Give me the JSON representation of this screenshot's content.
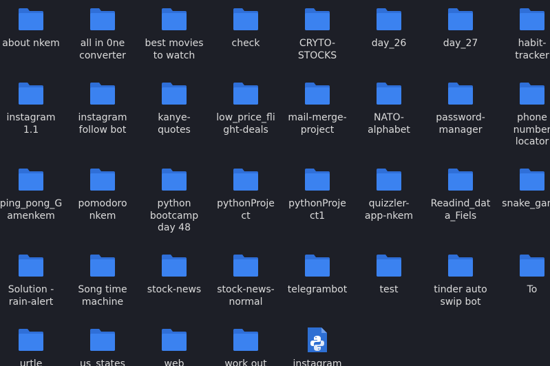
{
  "colors": {
    "background": "#1d1f27",
    "folder_back": "#2f6fd8",
    "folder_front": "#3b82f0",
    "label_text": "#dcdcdc",
    "file_body": "#2e6fd3",
    "file_fold": "#6fa0ec"
  },
  "items": [
    {
      "label": "about nkem",
      "icon": "folder-icon"
    },
    {
      "label": "all in 0ne converter",
      "icon": "folder-icon"
    },
    {
      "label": "best movies to watch",
      "icon": "folder-icon"
    },
    {
      "label": "check",
      "icon": "folder-icon"
    },
    {
      "label": "CRYTO-STOCKS",
      "icon": "folder-icon"
    },
    {
      "label": "day_26",
      "icon": "folder-icon"
    },
    {
      "label": "day_27",
      "icon": "folder-icon"
    },
    {
      "label": "habit-tracker",
      "icon": "folder-icon"
    },
    {
      "label": "instagram 1.1",
      "icon": "folder-icon"
    },
    {
      "label": "instagram follow bot",
      "icon": "folder-icon"
    },
    {
      "label": "kanye-quotes",
      "icon": "folder-icon"
    },
    {
      "label": "low_price_flight-deals",
      "icon": "folder-icon"
    },
    {
      "label": "mail-merge-project",
      "icon": "folder-icon"
    },
    {
      "label": "NATO-alphabet",
      "icon": "folder-icon"
    },
    {
      "label": "password-manager",
      "icon": "folder-icon"
    },
    {
      "label": "phone number locator",
      "icon": "folder-icon"
    },
    {
      "label": "ping_pong_Gamenkem",
      "icon": "folder-icon"
    },
    {
      "label": "pomodoronkem",
      "icon": "folder-icon"
    },
    {
      "label": "python bootcamp day 48",
      "icon": "folder-icon"
    },
    {
      "label": "pythonProject",
      "icon": "folder-icon"
    },
    {
      "label": "pythonProject1",
      "icon": "folder-icon"
    },
    {
      "label": "quizzler-app-nkem",
      "icon": "folder-icon"
    },
    {
      "label": "Readind_data_Fiels",
      "icon": "folder-icon"
    },
    {
      "label": "snake_game",
      "icon": "folder-icon"
    },
    {
      "label": "Solution - rain-alert",
      "icon": "folder-icon"
    },
    {
      "label": "Song time machine",
      "icon": "folder-icon"
    },
    {
      "label": "stock-news",
      "icon": "folder-icon"
    },
    {
      "label": "stock-news-normal",
      "icon": "folder-icon"
    },
    {
      "label": "telegrambot",
      "icon": "folder-icon"
    },
    {
      "label": "test",
      "icon": "folder-icon"
    },
    {
      "label": "tinder auto swip bot",
      "icon": "folder-icon"
    },
    {
      "label": "To",
      "icon": "folder-icon"
    },
    {
      "label": "urtle",
      "icon": "folder-icon"
    },
    {
      "label": "us_states",
      "icon": "folder-icon"
    },
    {
      "label": "web",
      "icon": "folder-icon"
    },
    {
      "label": "work out",
      "icon": "folder-icon"
    },
    {
      "label": "instagram",
      "icon": "python-file-icon"
    }
  ]
}
